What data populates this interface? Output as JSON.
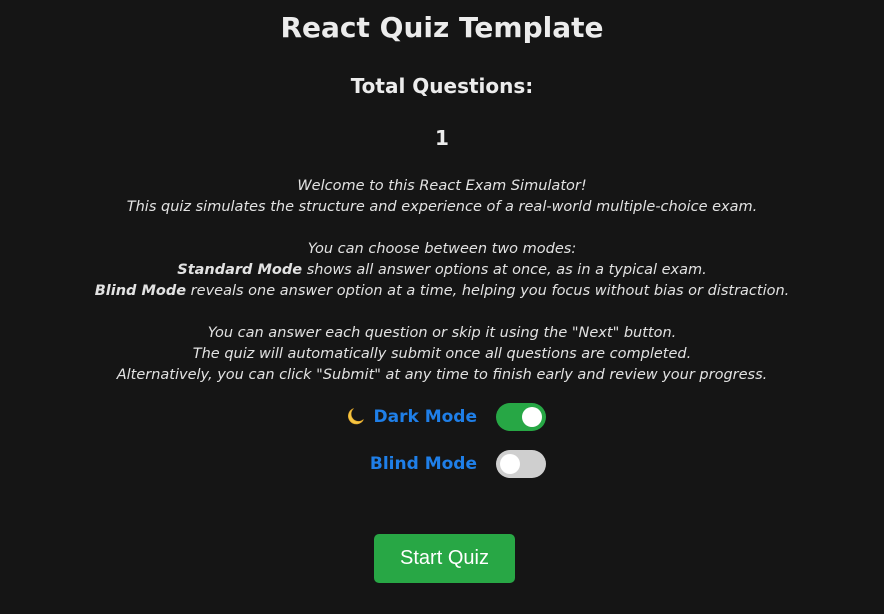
{
  "header": {
    "title": "React Quiz Template",
    "total_questions_label": "Total Questions:",
    "total_questions_value": "1"
  },
  "intro": {
    "line1": "Welcome to this React Exam Simulator!",
    "line2": "This quiz simulates the structure and experience of a real-world multiple-choice exam.",
    "line3": "You can choose between two modes:",
    "standard_mode_title": "Standard Mode",
    "standard_mode_desc": " shows all answer options at once, as in a typical exam.",
    "blind_mode_title": "Blind Mode",
    "blind_mode_desc": " reveals one answer option at a time, helping you focus without bias or distraction.",
    "line6": "You can answer each question or skip it using the \"Next\" button.",
    "line7": "The quiz will automatically submit once all questions are completed.",
    "line8": "Alternatively, you can click \"Submit\" at any time to finish early and review your progress."
  },
  "settings": {
    "dark_mode": {
      "label": "Dark Mode",
      "icon": "moon-icon",
      "enabled": true
    },
    "blind_mode": {
      "label": "Blind Mode",
      "enabled": false
    }
  },
  "actions": {
    "start_label": "Start Quiz"
  },
  "colors": {
    "background": "#151515",
    "accent_text": "#1f7fe8",
    "toggle_on": "#27a745",
    "toggle_off": "#cfcfcf",
    "button": "#28a745"
  }
}
